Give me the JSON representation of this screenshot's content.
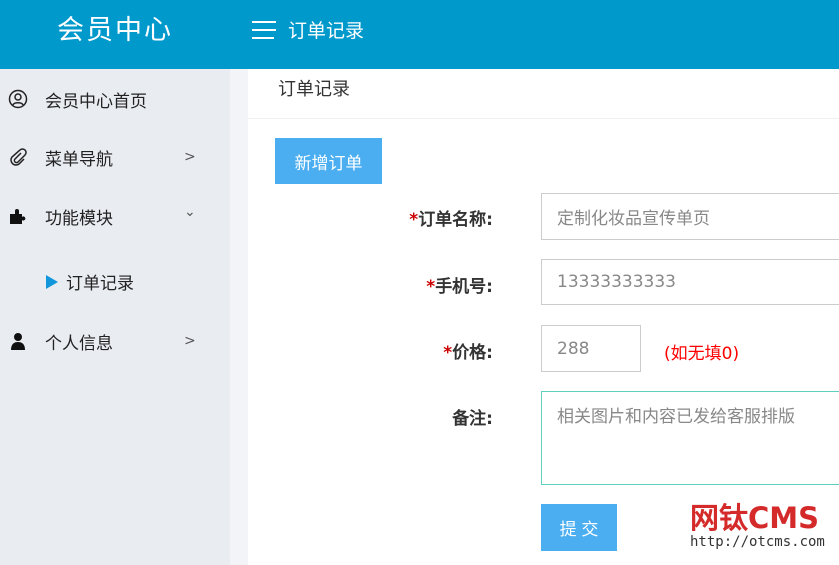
{
  "header": {
    "logo": "会员中心",
    "title": "订单记录"
  },
  "sidebar": {
    "items": [
      {
        "label": "会员中心首页",
        "icon": "user-circle-icon"
      },
      {
        "label": "菜单导航",
        "icon": "paperclip-icon",
        "arrow": ">"
      },
      {
        "label": "功能模块",
        "icon": "puzzle-icon",
        "arrow": "⌄"
      },
      {
        "label": "个人信息",
        "icon": "user-icon",
        "arrow": ">"
      }
    ],
    "sub_item": "订单记录"
  },
  "main": {
    "breadcrumb": "订单记录",
    "add_button": "新增订单",
    "form": {
      "name_label": "订单名称:",
      "name_value": "定制化妆品宣传单页",
      "phone_label": "手机号:",
      "phone_value": "13333333333",
      "price_label": "价格:",
      "price_value": "288",
      "price_hint": "(如无填0)",
      "note_label": "备注:",
      "note_value": "相关图片和内容已发给客服排版",
      "required_mark": "*",
      "submit": "提 交"
    }
  },
  "watermark": {
    "brand": "网钛CMS",
    "url": "http://otcms.com"
  },
  "colors": {
    "header": "#0099cc",
    "button": "#4aaef1",
    "sidebar": "#e9ecf1"
  }
}
